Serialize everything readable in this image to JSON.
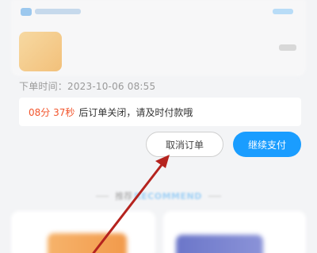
{
  "order": {
    "placed_time": "下单时间：2023-10-06 08:55",
    "countdown": "08分 37秒",
    "countdown_message": "后订单关闭，请及时付款哦",
    "cancel_label": "取消订单",
    "pay_label": "继续支付"
  },
  "recommend": {
    "label_cn": "推荐",
    "label_en": "RECOMMEND"
  },
  "colors": {
    "accent_blue": "#1a9dff",
    "countdown_red": "#f2552c",
    "annotation_arrow": "#b5231e"
  },
  "icons": {
    "annotation": "arrow-pointer-icon"
  }
}
